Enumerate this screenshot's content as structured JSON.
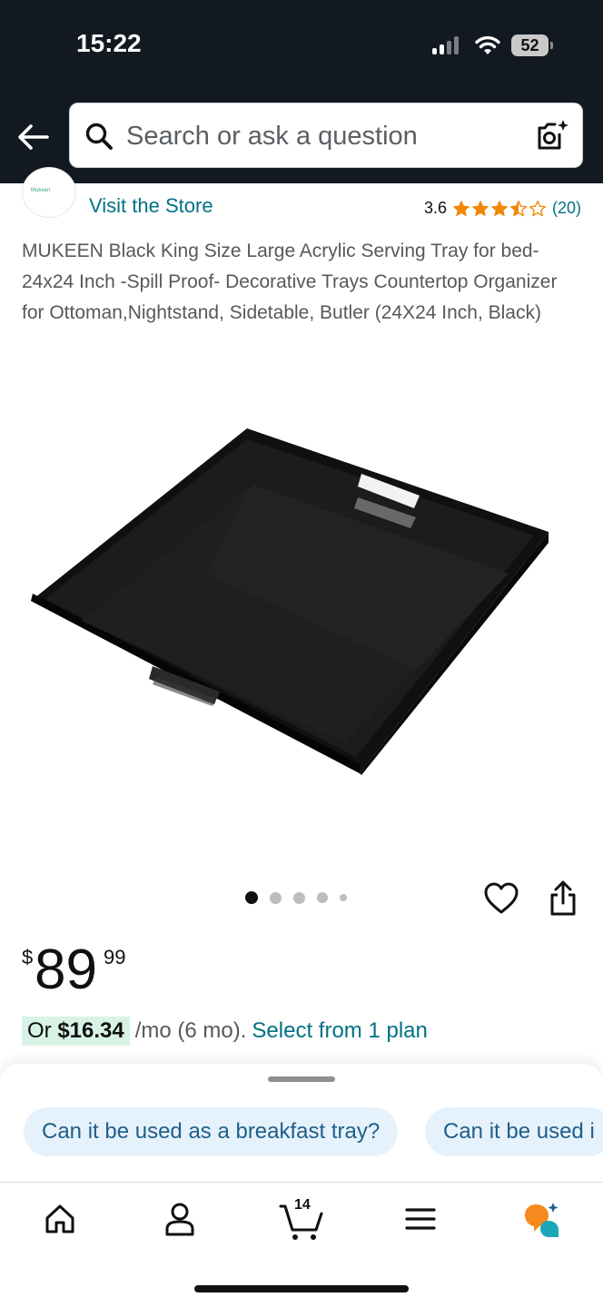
{
  "status_bar": {
    "time": "15:22",
    "battery": "52"
  },
  "search": {
    "placeholder": "Search or ask a question"
  },
  "store": {
    "logo_text": "Mukeen",
    "visit_label": "Visit the Store"
  },
  "rating": {
    "value": "3.6",
    "stars_filled": 3.6,
    "count": "(20)"
  },
  "product": {
    "title": "MUKEEN Black King Size Large Acrylic Serving Tray for bed- 24x24 Inch -Spill Proof- Decorative Trays Countertop Organizer for Ottoman,Nightstand, Sidetable, Butler (24X24 Inch, Black)",
    "image_count": 5,
    "active_image_index": 0
  },
  "price": {
    "symbol": "$",
    "whole": "89",
    "fraction": "99"
  },
  "installment": {
    "prefix": "Or ",
    "amount": "$16.34",
    "suffix": "/mo (6 mo).",
    "link": "Select from 1 plan"
  },
  "questions": [
    "Can it be used as a breakfast tray?",
    "Can it be used i"
  ],
  "nav": {
    "cart_count": "14"
  },
  "colors": {
    "header_bg": "#131921",
    "link": "#007185",
    "star": "#f08804",
    "chip_bg": "#e6f2fb",
    "installment_bg": "#d8f3e5",
    "rufus_orange": "#f68a1e",
    "rufus_teal": "#1aa6b7"
  },
  "icons": {
    "back": "arrow-left-icon",
    "search": "search-icon",
    "camera": "camera-sparkle-icon",
    "heart": "heart-icon",
    "share": "share-icon",
    "home": "home-icon",
    "account": "account-icon",
    "cart": "cart-icon",
    "menu": "menu-icon",
    "rufus": "rufus-icon"
  }
}
